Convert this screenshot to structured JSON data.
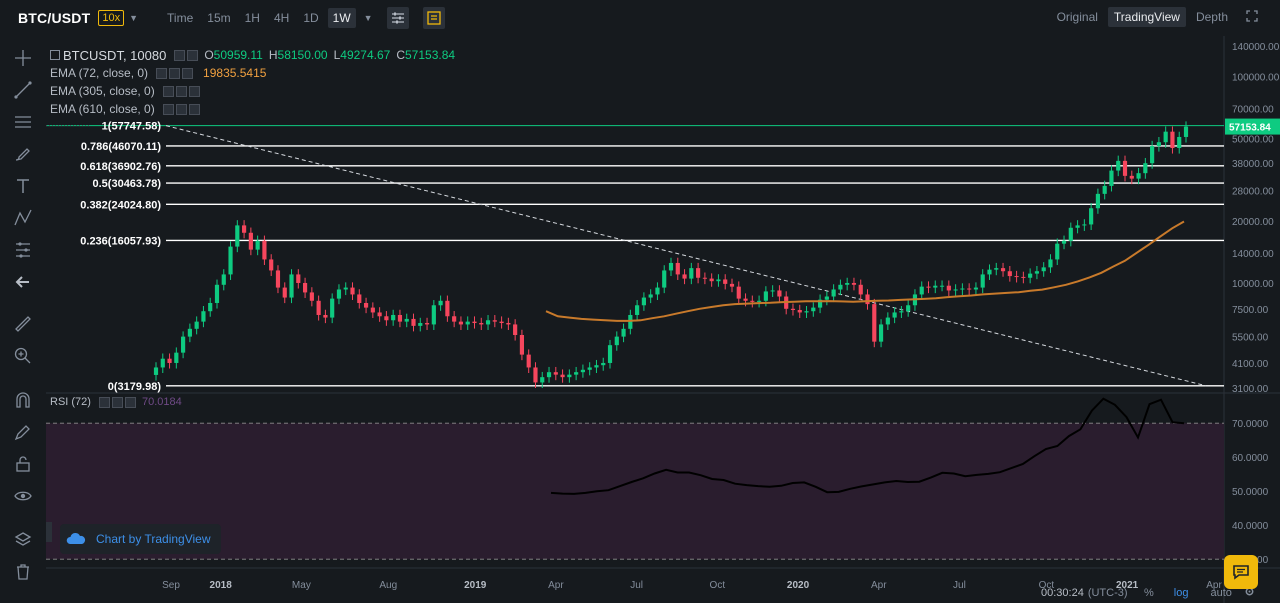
{
  "header": {
    "pair": "BTC/USDT",
    "leverage": "10x",
    "intervals": [
      "Time",
      "15m",
      "1H",
      "4H",
      "1D",
      "1W"
    ],
    "active_interval": "1W",
    "views": [
      "Original",
      "TradingView",
      "Depth"
    ],
    "active_view": "TradingView"
  },
  "legend": {
    "symbol": "BTCUSDT, 10080",
    "open_label": "O",
    "open": "50959.11",
    "high_label": "H",
    "high": "58150.00",
    "low_label": "L",
    "low": "49274.67",
    "close_label": "C",
    "close": "57153.84",
    "ema1": "EMA (72, close, 0)",
    "ema1_value": "19835.5415",
    "ema2": "EMA (305, close, 0)",
    "ema3": "EMA (610, close, 0)"
  },
  "rsi": {
    "label": "RSI (72)",
    "value": "70.0184"
  },
  "badge": {
    "text": "Chart by TradingView"
  },
  "footer": {
    "time": "00:30:24",
    "tz": "(UTC-3)",
    "percent": "%",
    "log": "log",
    "auto": "auto"
  },
  "colors": {
    "background": "#161a1e",
    "up": "#0ecb81",
    "down": "#f6465d",
    "ema": "#c87a2b",
    "fib": "#ffffff",
    "last_price": "#0ecb81",
    "rsi_band": "#2a1d2e"
  },
  "chart_data": [
    {
      "type": "candlestick",
      "scale": "log",
      "timeframe": "1W",
      "x_tick_labels": [
        "Sep",
        "2018",
        "May",
        "Aug",
        "2019",
        "Apr",
        "Jul",
        "Oct",
        "2020",
        "Apr",
        "Jul",
        "Oct",
        "2021",
        "Apr"
      ],
      "y_tick_labels": [
        "140000.00",
        "100000.00",
        "70000.00",
        "50000.00",
        "38000.00",
        "28000.00",
        "20000.00",
        "14000.00",
        "10000.00",
        "7500.00",
        "5500.00",
        "4100.00",
        "3100.00"
      ],
      "ylim": [
        3000,
        150000
      ],
      "last_price": "57153.84",
      "fib_levels": [
        {
          "label": "1(57747.58)",
          "ratio": 1,
          "price": 57747.58
        },
        {
          "label": "0.786(46070.11)",
          "ratio": 0.786,
          "price": 46070.11
        },
        {
          "label": "0.618(36902.76)",
          "ratio": 0.618,
          "price": 36902.76
        },
        {
          "label": "0.5(30463.78)",
          "ratio": 0.5,
          "price": 30463.78
        },
        {
          "label": "0.382(24024.80)",
          "ratio": 0.382,
          "price": 24024.8
        },
        {
          "label": "0.236(16057.93)",
          "ratio": 0.236,
          "price": 16057.93
        },
        {
          "label": "0(3179.98)",
          "ratio": 0,
          "price": 3179.98
        }
      ],
      "close_series": [
        3900,
        4300,
        4100,
        4600,
        5500,
        6000,
        6500,
        7300,
        8000,
        9800,
        11000,
        15000,
        19000,
        17500,
        14500,
        16000,
        13000,
        11500,
        9500,
        8500,
        11000,
        10000,
        9000,
        8200,
        7000,
        6800,
        8400,
        9300,
        9500,
        8800,
        8000,
        7600,
        7200,
        6900,
        6600,
        7000,
        6500,
        6700,
        6200,
        6400,
        6300,
        7800,
        8200,
        6900,
        6500,
        6300,
        6500,
        6400,
        6300,
        6600,
        6500,
        6400,
        6300,
        5600,
        4500,
        3900,
        3300,
        3500,
        3700,
        3600,
        3500,
        3600,
        3700,
        3800,
        3900,
        4000,
        4100,
        5000,
        5500,
        6000,
        7000,
        7800,
        8500,
        8800,
        9500,
        11500,
        12500,
        11000,
        10500,
        11800,
        10600,
        10500,
        10200,
        10400,
        9900,
        9600,
        8400,
        8200,
        8100,
        8200,
        9100,
        9200,
        8600,
        7500,
        7400,
        7200,
        7300,
        7600,
        8300,
        8600,
        9300,
        9800,
        10000,
        9800,
        8800,
        7900,
        5200,
        6300,
        6800,
        7200,
        7300,
        7800,
        8800,
        9600,
        9500,
        9700,
        9700,
        9200,
        9300,
        9400,
        9300,
        9500,
        11000,
        11600,
        11800,
        11400,
        10800,
        10700,
        10600,
        11100,
        11400,
        11900,
        13000,
        15500,
        16000,
        18500,
        19000,
        19200,
        23000,
        27000,
        29500,
        35000,
        39000,
        33000,
        32000,
        34000,
        38000,
        46000,
        48000,
        54000,
        45000,
        50900,
        57153.84
      ],
      "ema_series": [
        7300,
        6900,
        6800,
        6700,
        6650,
        6600,
        6550,
        6550,
        6600,
        6750,
        6900,
        7100,
        7300,
        7500,
        7650,
        7800,
        7900,
        7950,
        7990,
        8020,
        8080,
        8120,
        8150,
        8160,
        8170,
        8140,
        8120,
        8150,
        8200,
        8230,
        8280,
        8330,
        8370,
        8440,
        8540,
        8630,
        8700,
        8800,
        8880,
        8950,
        9020,
        9160,
        9290,
        9530,
        9800,
        10180,
        10640,
        11200,
        12000,
        12800,
        14000,
        15300,
        16800,
        18400,
        19835
      ]
    },
    {
      "type": "line",
      "name": "RSI (72)",
      "y_tick_labels": [
        "70.0000",
        "60.0000",
        "50.0000",
        "40.0000",
        "30.0000"
      ],
      "ylim": [
        28,
        78
      ],
      "values": [
        49.5,
        49.3,
        49.2,
        49.5,
        50,
        50.3,
        51.5,
        52.7,
        53.8,
        55.2,
        56.3,
        55.5,
        55.5,
        54.7,
        53.6,
        53.3,
        52.2,
        51.8,
        51.5,
        51.3,
        51.6,
        52.4,
        52.6,
        51.3,
        49.7,
        49.8,
        50.7,
        51.4,
        52,
        52.6,
        53,
        52.7,
        52.8,
        54,
        55.4,
        55.2,
        54.4,
        54.8,
        55.1,
        55.6,
        56.8,
        58,
        60.3,
        62.4,
        63.3,
        66.2,
        68.2,
        73.7,
        77.2,
        75.4,
        71.8,
        65.8,
        75.6,
        76.9,
        70.3,
        70
      ]
    }
  ]
}
